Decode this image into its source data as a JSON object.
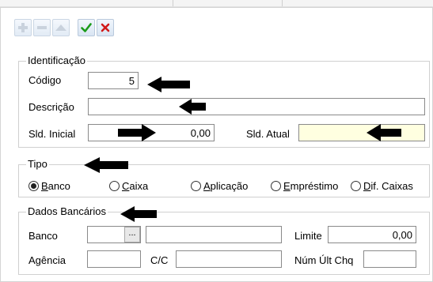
{
  "toolbar": {
    "buttons": [
      {
        "icon": "plus-icon"
      },
      {
        "icon": "minus-icon"
      },
      {
        "icon": "up-triangle-icon"
      },
      {
        "icon": "check-icon",
        "color": "#1a9b1a"
      },
      {
        "icon": "close-icon",
        "color": "#d11a1a"
      }
    ]
  },
  "identificacao": {
    "legend": "Identificação",
    "codigo_label": "Código",
    "codigo_value": "5",
    "descricao_label": "Descrição",
    "descricao_value": "",
    "sld_inicial_label": "Sld. Inicial",
    "sld_inicial_value": "0,00",
    "sld_atual_label": "Sld. Atual",
    "sld_atual_value": ""
  },
  "tipo": {
    "legend": "Tipo",
    "options": [
      {
        "key": "B",
        "rest": "anco",
        "checked": true
      },
      {
        "key": "C",
        "rest": "aixa",
        "checked": false
      },
      {
        "key": "A",
        "rest": "plicação",
        "checked": false
      },
      {
        "key": "E",
        "rest": "mpréstimo",
        "checked": false
      },
      {
        "pre": "",
        "key": "D",
        "rest": "if. Caixas",
        "checked": false
      }
    ],
    "option_5_prefix": ""
  },
  "dados_bancarios": {
    "legend": "Dados Bancários",
    "banco_label": "Banco",
    "banco_code": "",
    "lookup_label": "...",
    "banco_name": "",
    "limite_label": "Limite",
    "limite_value": "0,00",
    "agencia_label": "Agência",
    "agencia_value": "",
    "cc_label": "C/C",
    "cc_value": "",
    "num_ult_chq_label": "Núm Últ Chq",
    "num_ult_chq_value": ""
  },
  "colors": {
    "arrow": "#000000",
    "readonly_bg": "#ffffe0",
    "accept": "#1a9b1a",
    "cancel": "#d11a1a"
  }
}
